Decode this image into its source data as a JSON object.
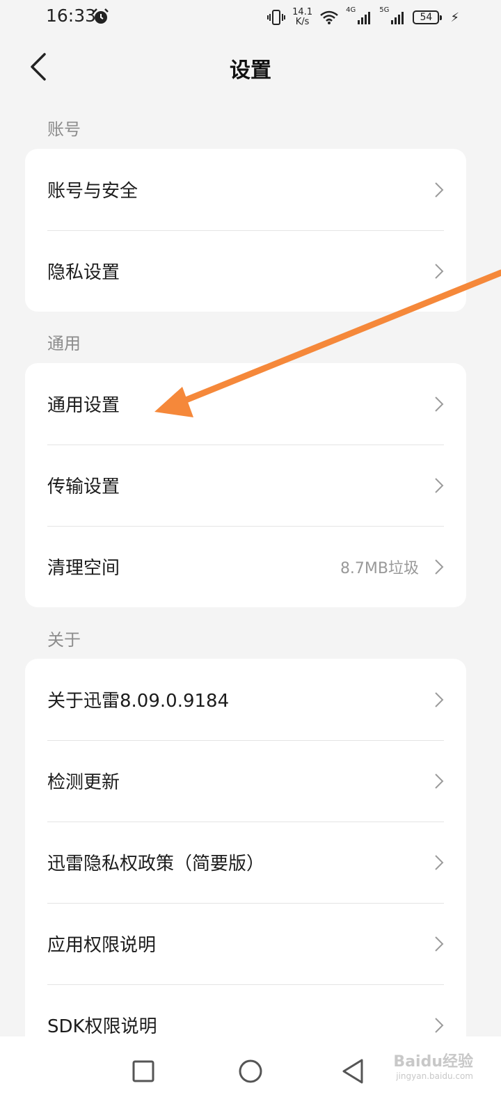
{
  "status_bar": {
    "time": "16:33",
    "speed_value": "14.1",
    "speed_unit": "K/s",
    "net1": "4G",
    "net2": "5G",
    "battery": "54"
  },
  "header": {
    "title": "设置"
  },
  "sections": {
    "account": {
      "label": "账号",
      "items": [
        {
          "label": "账号与安全"
        },
        {
          "label": "隐私设置"
        }
      ]
    },
    "general": {
      "label": "通用",
      "items": [
        {
          "label": "通用设置"
        },
        {
          "label": "传输设置"
        },
        {
          "label": "清理空间",
          "value": "8.7MB垃圾"
        }
      ]
    },
    "about": {
      "label": "关于",
      "items": [
        {
          "label": "关于迅雷8.09.0.9184"
        },
        {
          "label": "检测更新"
        },
        {
          "label": "迅雷隐私权政策（简要版）"
        },
        {
          "label": "应用权限说明"
        },
        {
          "label": "SDK权限说明"
        }
      ]
    }
  },
  "annotation": {
    "arrow_color": "#f5883a"
  },
  "watermark": {
    "text": "Baidu经验",
    "sub": "jingyan.baidu.com"
  }
}
